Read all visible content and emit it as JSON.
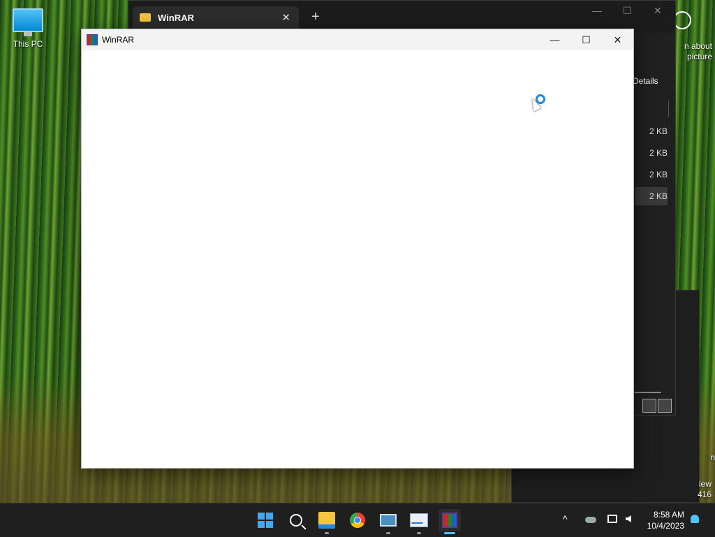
{
  "desktop": {
    "this_pc_label": "This PC",
    "info_icon_text_1": "n about",
    "info_icon_text_2": "picture",
    "bg_text_1": "n",
    "bg_text_2": "iew",
    "bg_text_3": "416"
  },
  "explorer": {
    "tab_title": "WinRAR",
    "tab_close": "✕",
    "new_tab": "+",
    "minimize": "—",
    "maximize": "☐",
    "close": "✕",
    "details_label": "Details",
    "sizes": [
      "2 KB",
      "2 KB",
      "2 KB",
      "2 KB"
    ]
  },
  "winrar": {
    "title": "WinRAR",
    "minimize": "—",
    "maximize": "☐",
    "close": "✕"
  },
  "taskbar": {
    "apps": [
      {
        "name": "start",
        "icon": "windows-logo-icon"
      },
      {
        "name": "search",
        "icon": "search-icon"
      },
      {
        "name": "file-explorer",
        "icon": "folder-icon"
      },
      {
        "name": "chrome",
        "icon": "chrome-icon"
      },
      {
        "name": "remote-desktop",
        "icon": "remote-desktop-icon"
      },
      {
        "name": "performance-monitor",
        "icon": "performance-icon"
      },
      {
        "name": "winrar",
        "icon": "winrar-icon"
      }
    ],
    "tray_chevron": "^",
    "time": "8:58 AM",
    "date": "10/4/2023"
  },
  "colors": {
    "accent": "#4cc2ff",
    "taskbar_bg": "#1f1f1f",
    "explorer_bg": "#202020"
  }
}
